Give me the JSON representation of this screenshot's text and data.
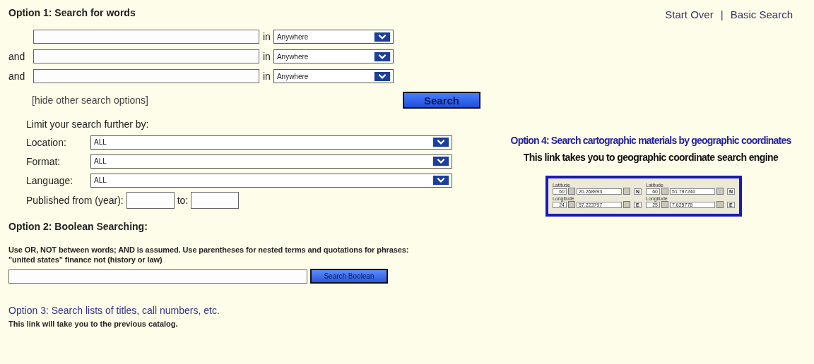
{
  "header_links": {
    "items": [
      "Start Over",
      "Basic Search"
    ],
    "separator": "|"
  },
  "option1": {
    "title": "Option 1: Search for words",
    "rows": [
      {
        "connector": "",
        "in_label": "in",
        "scope": "Anywhere"
      },
      {
        "connector": "and",
        "in_label": "in",
        "scope": "Anywhere"
      },
      {
        "connector": "and",
        "in_label": "in",
        "scope": "Anywhere"
      }
    ],
    "hide_link": "[hide other search options]",
    "search_button": "Search"
  },
  "limits": {
    "title": "Limit your search further by:",
    "filters": [
      {
        "label": "Location:",
        "value": "ALL"
      },
      {
        "label": "Format:",
        "value": "ALL"
      },
      {
        "label": "Language:",
        "value": "ALL"
      }
    ],
    "published_from": "Published from (year):",
    "published_to": "to:"
  },
  "option2": {
    "title": "Option 2: Boolean Searching:",
    "instructions": "Use OR, NOT between words; AND is assumed. Use parentheses for nested terms and quotations for phrases: \"united states\" finance not (history or law)",
    "button": "Search Boolean"
  },
  "option3": {
    "link": "Option 3: Search lists of titles, call numbers, etc.",
    "note": "This link will take you to the previous catalog."
  },
  "option4": {
    "title": "Option 4: Search cartographic materials by geographic coordinates",
    "subtitle": "This link takes you to geographic coordinate search engine",
    "preview": [
      {
        "lat_label": "Latitude",
        "lat_deg": "60",
        "lat_min": "20.268993",
        "lat_dir": "N",
        "lon_label": "Longitude",
        "lon_deg": "24",
        "lon_min": "57.223797",
        "lon_dir": "E"
      },
      {
        "lat_label": "Latitude",
        "lat_deg": "60",
        "lat_min": "51.797240",
        "lat_dir": "N",
        "lon_label": "Longitude",
        "lon_deg": "25",
        "lon_min": "7.625778",
        "lon_dir": "E"
      }
    ]
  }
}
